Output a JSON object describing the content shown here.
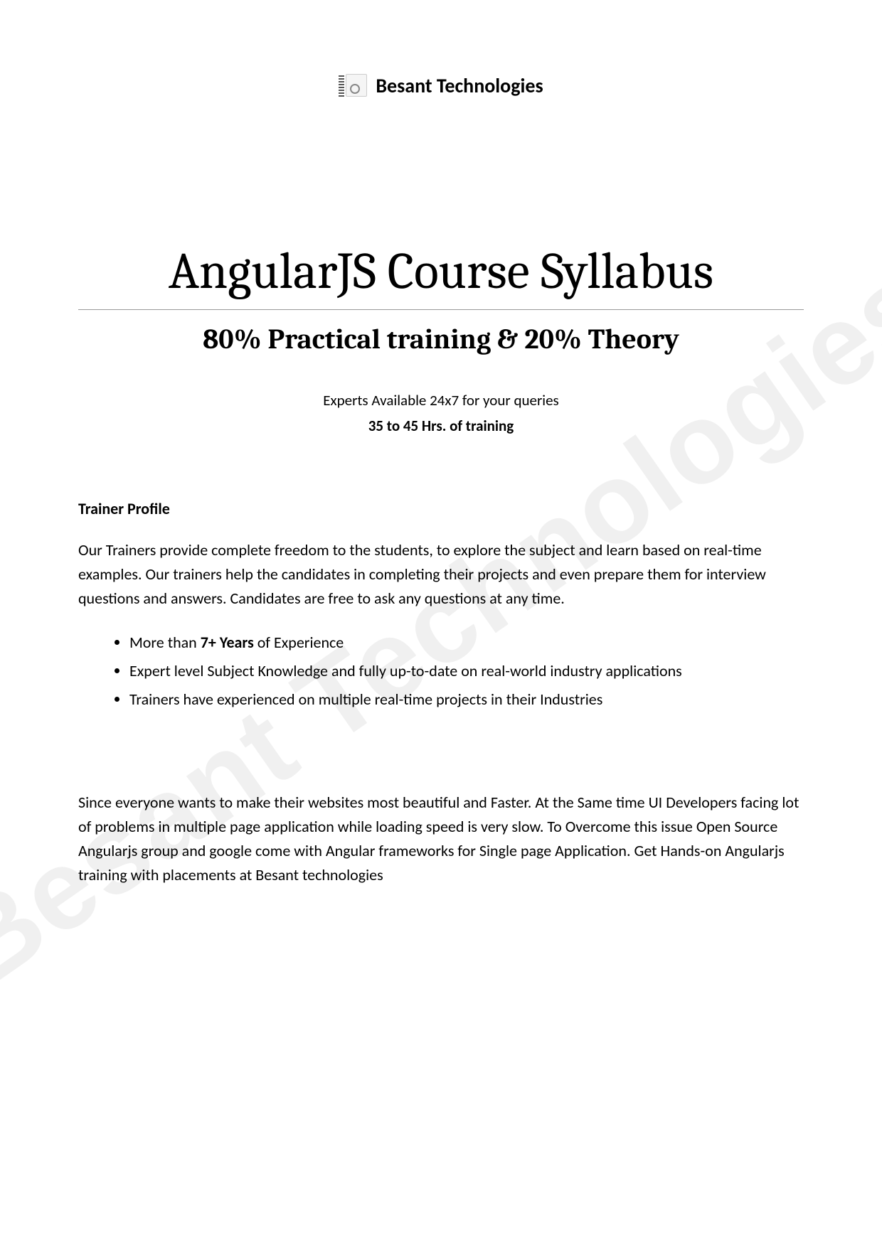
{
  "header": {
    "company_name": "Besant Technologies"
  },
  "title": "AngularJS Course Syllabus",
  "subtitle": "80% Practical training & 20% Theory",
  "info": {
    "availability": "Experts Available 24x7 for your queries",
    "duration": "35 to 45 Hrs. of training"
  },
  "trainer_profile": {
    "heading": "Trainer Profile",
    "description": "Our Trainers provide complete freedom to the students, to explore the subject and learn based on real-time examples. Our trainers help the candidates in completing their projects and even prepare them for interview questions and answers. Candidates are free to ask any questions at any time.",
    "bullets": [
      {
        "prefix": "More than ",
        "bold": "7+ Years",
        "suffix": " of Experience"
      },
      {
        "prefix": "Expert level Subject Knowledge and fully up-to-date on real-world industry applications",
        "bold": "",
        "suffix": ""
      },
      {
        "prefix": "Trainers have experienced on multiple real-time projects in their Industries",
        "bold": "",
        "suffix": ""
      }
    ]
  },
  "footer_paragraph": "Since everyone wants to make their websites most beautiful and Faster. At the Same time UI Developers facing lot of problems in multiple page application while loading speed is very slow. To Overcome this issue Open Source Angularjs group and google come with Angular frameworks for Single page Application. Get Hands-on Angularjs training with placements at Besant technologies",
  "watermark": "Besant Technologies"
}
